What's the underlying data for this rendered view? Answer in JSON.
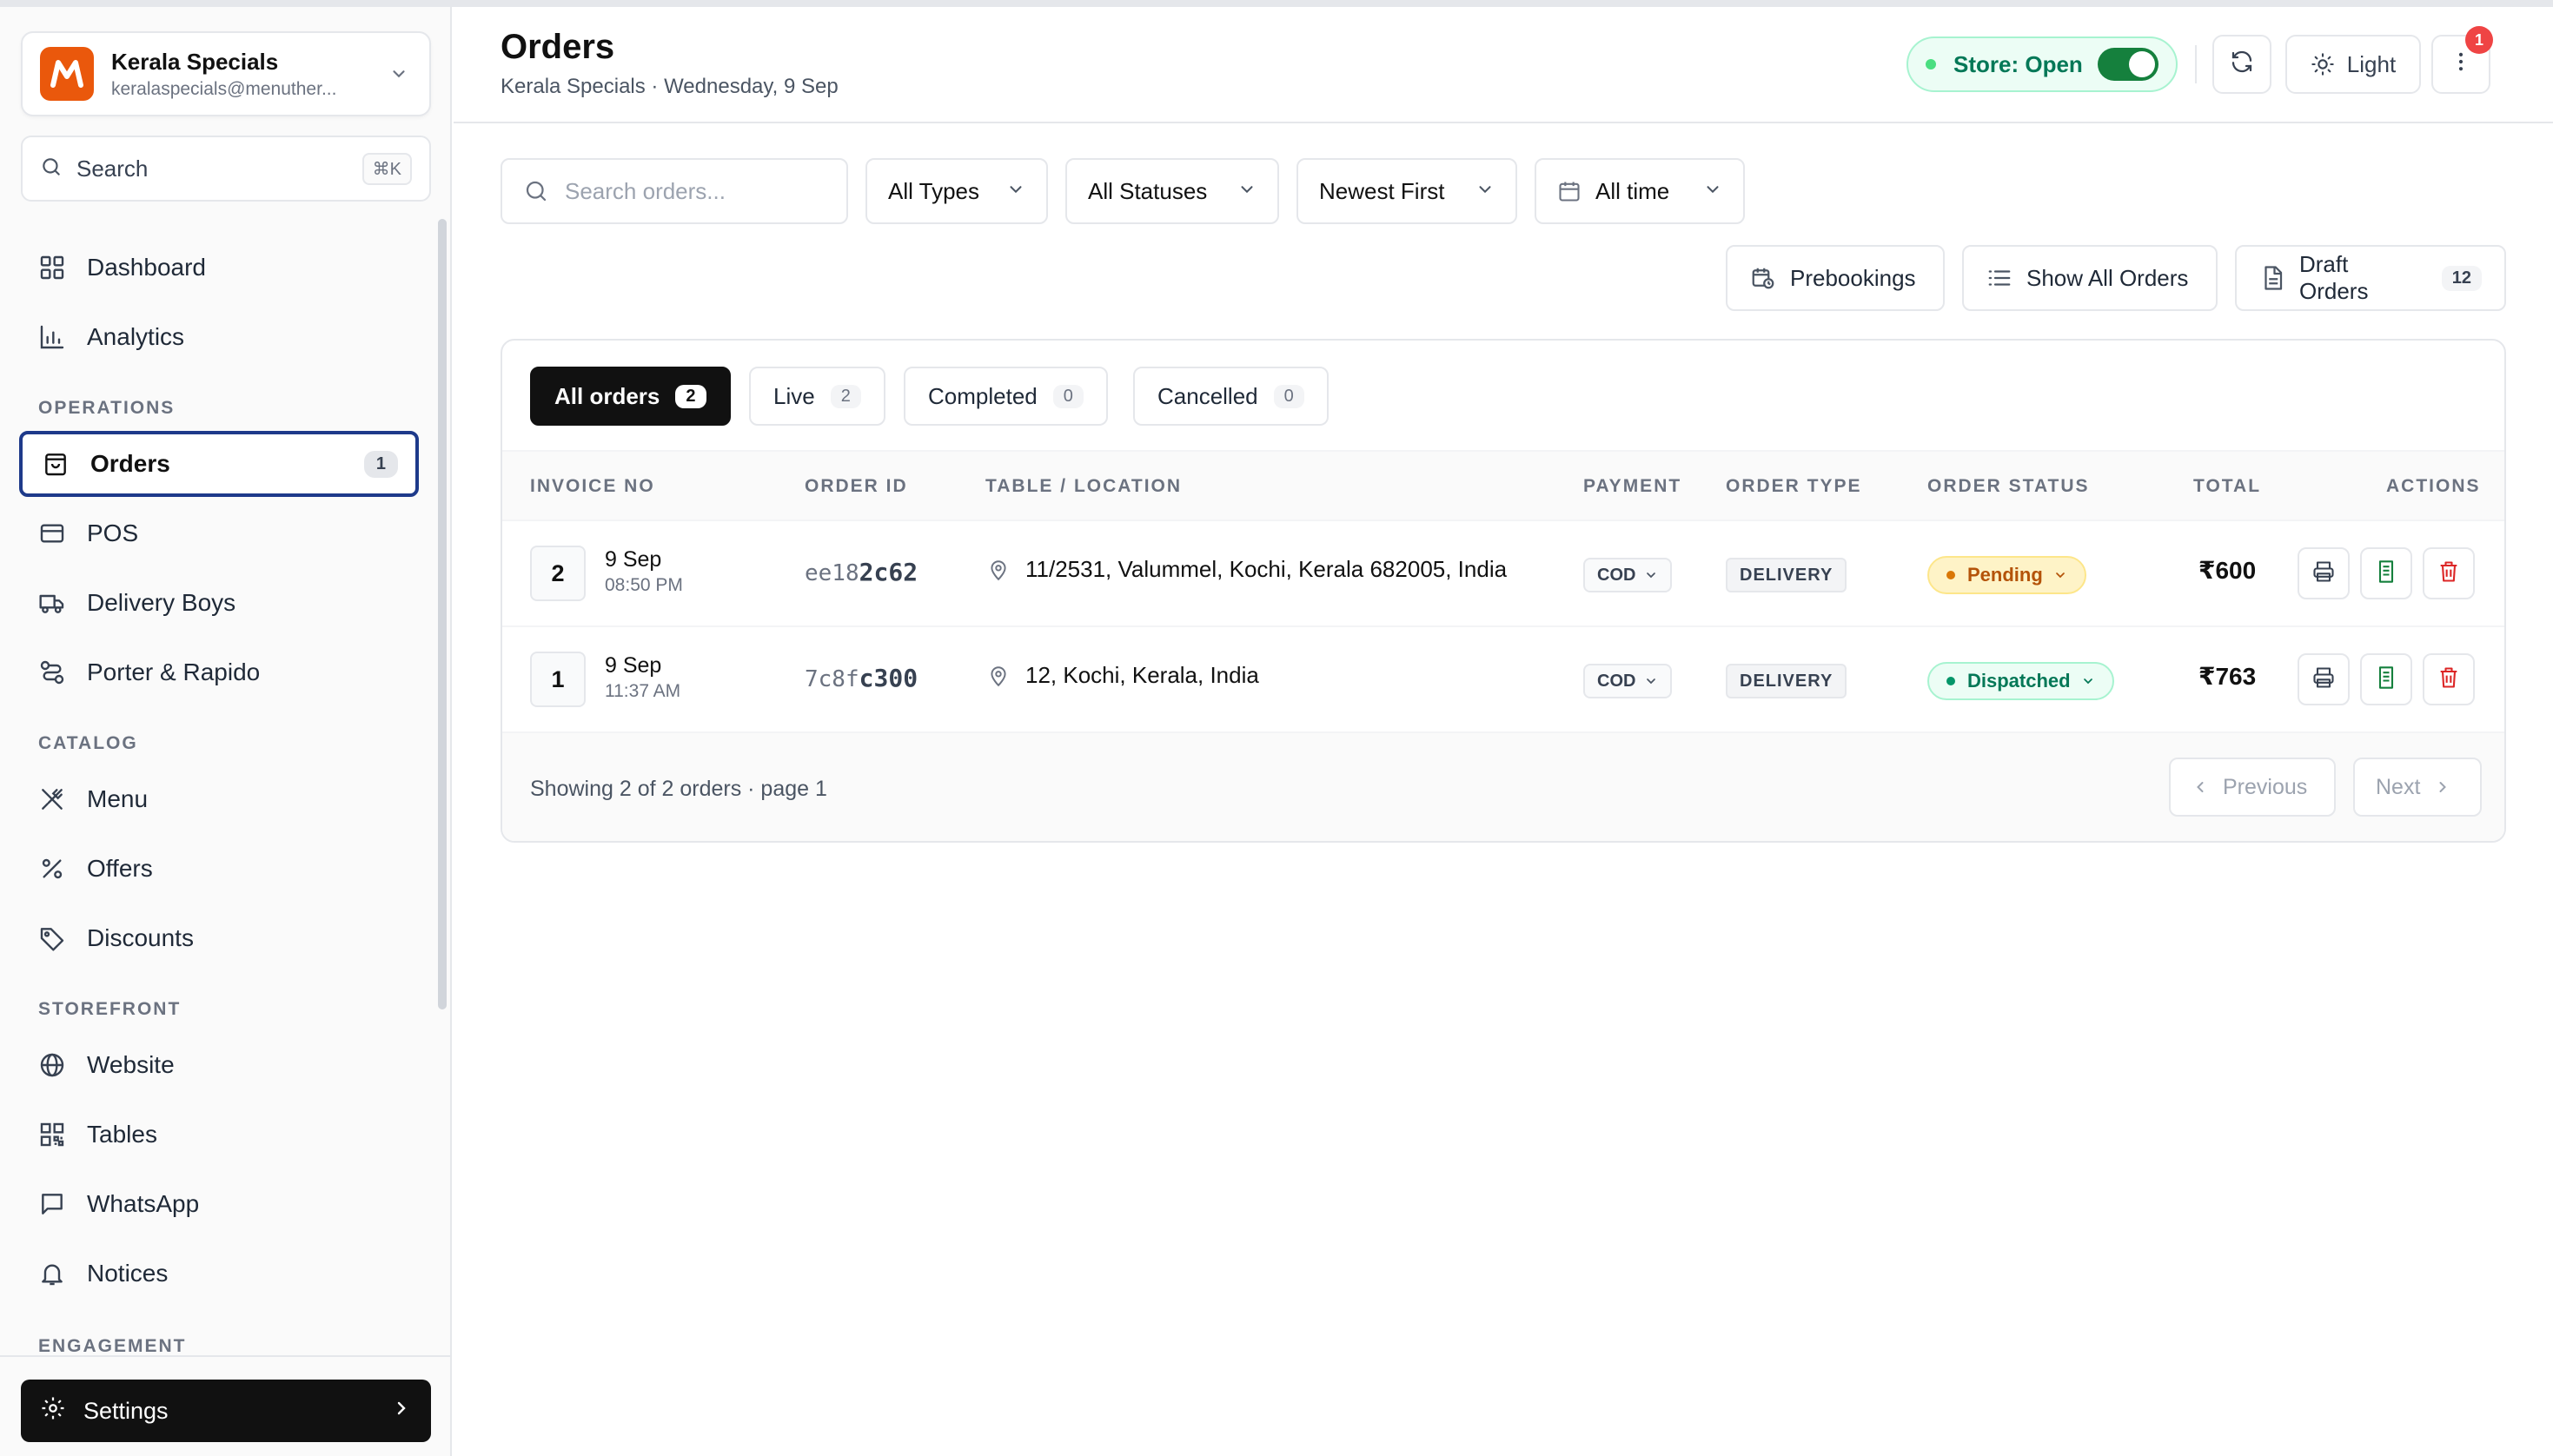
{
  "sidebar": {
    "store": {
      "name": "Kerala Specials",
      "email": "keralaspecials@menuther..."
    },
    "search": {
      "label": "Search",
      "shortcut": "⌘K"
    },
    "items_top": [
      {
        "label": "Dashboard",
        "icon": "grid-icon"
      },
      {
        "label": "Analytics",
        "icon": "bar-chart-icon"
      }
    ],
    "sections": {
      "operations": "OPERATIONS",
      "catalog": "CATALOG",
      "storefront": "STOREFRONT",
      "engagement": "ENGAGEMENT"
    },
    "operations": [
      {
        "label": "Orders",
        "icon": "shopping-bag-icon",
        "badge": "1",
        "active": true
      },
      {
        "label": "POS",
        "icon": "credit-card-icon"
      },
      {
        "label": "Delivery Boys",
        "icon": "truck-icon"
      },
      {
        "label": "Porter & Rapido",
        "icon": "route-icon"
      }
    ],
    "catalog": [
      {
        "label": "Menu",
        "icon": "utensils-icon"
      },
      {
        "label": "Offers",
        "icon": "percent-icon"
      },
      {
        "label": "Discounts",
        "icon": "tag-icon"
      }
    ],
    "storefront": [
      {
        "label": "Website",
        "icon": "globe-icon"
      },
      {
        "label": "Tables",
        "icon": "qr-code-icon"
      },
      {
        "label": "WhatsApp",
        "icon": "message-square-icon"
      },
      {
        "label": "Notices",
        "icon": "bell-icon"
      }
    ],
    "settings_label": "Settings"
  },
  "header": {
    "title": "Orders",
    "subtitle": "Kerala Specials · Wednesday, 9 Sep",
    "store_status": "Store: Open",
    "store_open": true,
    "theme_label": "Light",
    "notification_count": "1"
  },
  "filters": {
    "search_placeholder": "Search orders...",
    "type": "All Types",
    "status": "All Statuses",
    "sort": "Newest First",
    "time": "All time"
  },
  "actions": {
    "prebookings": "Prebookings",
    "show_all": "Show All Orders",
    "drafts": "Draft Orders",
    "drafts_count": "12"
  },
  "tabs": [
    {
      "label": "All orders",
      "count": "2",
      "active": true
    },
    {
      "label": "Live",
      "count": "2"
    },
    {
      "label": "Completed",
      "count": "0"
    },
    {
      "label": "Cancelled",
      "count": "0"
    }
  ],
  "table": {
    "columns": [
      "INVOICE NO",
      "ORDER ID",
      "TABLE / LOCATION",
      "PAYMENT",
      "ORDER TYPE",
      "ORDER STATUS",
      "TOTAL",
      "ACTIONS"
    ],
    "rows": [
      {
        "invoice": "2",
        "date": "9 Sep",
        "time": "08:50 PM",
        "order_id_prefix": "ee18",
        "order_id_suffix": "2c62",
        "location": "11/2531, Valummel, Kochi, Kerala 682005, India",
        "payment": "COD",
        "order_type": "DELIVERY",
        "status": "Pending",
        "total": "₹600"
      },
      {
        "invoice": "1",
        "date": "9 Sep",
        "time": "11:37 AM",
        "order_id_prefix": "7c8f",
        "order_id_suffix": "c300",
        "location": "12, Kochi, Kerala, India",
        "payment": "COD",
        "order_type": "DELIVERY",
        "status": "Dispatched",
        "total": "₹763"
      }
    ]
  },
  "footer": {
    "showing": "Showing 2 of 2 orders · page 1",
    "previous": "Previous",
    "next": "Next"
  },
  "colors": {
    "accent": "#ea580c",
    "active_border": "#1e3a8a",
    "open_green": "#15803d",
    "pending": "#b45309",
    "dispatched": "#047857",
    "danger": "#dc2626"
  }
}
